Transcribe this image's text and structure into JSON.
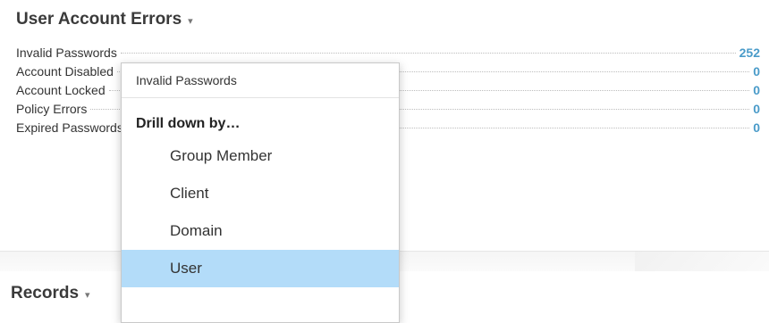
{
  "panel": {
    "title": "User Account Errors",
    "caret": "▾",
    "rows": [
      {
        "label": "Invalid Passwords",
        "value": "252"
      },
      {
        "label": "Account Disabled",
        "value": "0"
      },
      {
        "label": "Account Locked",
        "value": "0"
      },
      {
        "label": "Policy Errors",
        "value": "0"
      },
      {
        "label": "Expired Passwords",
        "value": "0"
      }
    ]
  },
  "records": {
    "title": "Records",
    "caret": "▾"
  },
  "menu": {
    "header": "Invalid Passwords",
    "section": "Drill down by…",
    "items": [
      "Group Member",
      "Client",
      "Domain",
      "User"
    ],
    "highlighted_item": "User",
    "highlight_color": "#b3dcf9"
  },
  "colors": {
    "value_accent": "#4a9bc9"
  }
}
